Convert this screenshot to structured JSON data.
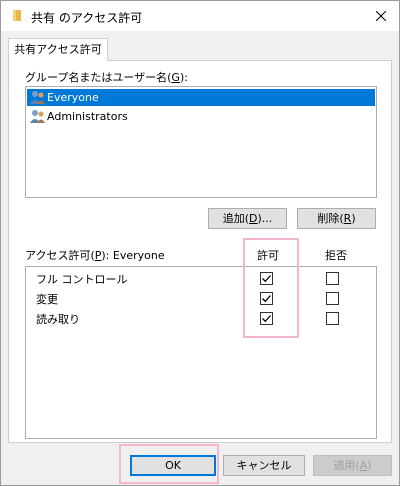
{
  "window": {
    "title": "共有 のアクセス許可",
    "icons": {
      "title": "folder-icon",
      "close": "close-icon"
    }
  },
  "tab": {
    "label": "共有アクセス許可"
  },
  "group_section": {
    "label_prefix": "グループ名またはユーザー名(",
    "label_key": "G",
    "label_suffix": "):",
    "users": [
      {
        "name": "Everyone",
        "icon": "user-group-icon",
        "selected": true
      },
      {
        "name": "Administrators",
        "icon": "user-group-icon",
        "selected": false
      }
    ]
  },
  "user_buttons": {
    "add": {
      "prefix": "追加(",
      "key": "D",
      "suffix": ")..."
    },
    "remove": {
      "prefix": "削除(",
      "key": "R",
      "suffix": ")"
    }
  },
  "permissions": {
    "label_prefix": "アクセス許可(",
    "label_key": "P",
    "label_suffix": "): Everyone",
    "col_allow": "許可",
    "col_deny": "拒否",
    "rows": [
      {
        "name": "フル コントロール",
        "allow": true,
        "deny": false
      },
      {
        "name": "変更",
        "allow": true,
        "deny": false
      },
      {
        "name": "読み取り",
        "allow": true,
        "deny": false
      }
    ]
  },
  "footer": {
    "ok": "OK",
    "cancel": "キャンセル",
    "apply": {
      "prefix": "適用(",
      "key": "A",
      "suffix": ")",
      "disabled": true
    }
  },
  "colors": {
    "selection": "#0078d7",
    "highlight": "#f4b6cf",
    "default_button_border": "#0078d7"
  }
}
